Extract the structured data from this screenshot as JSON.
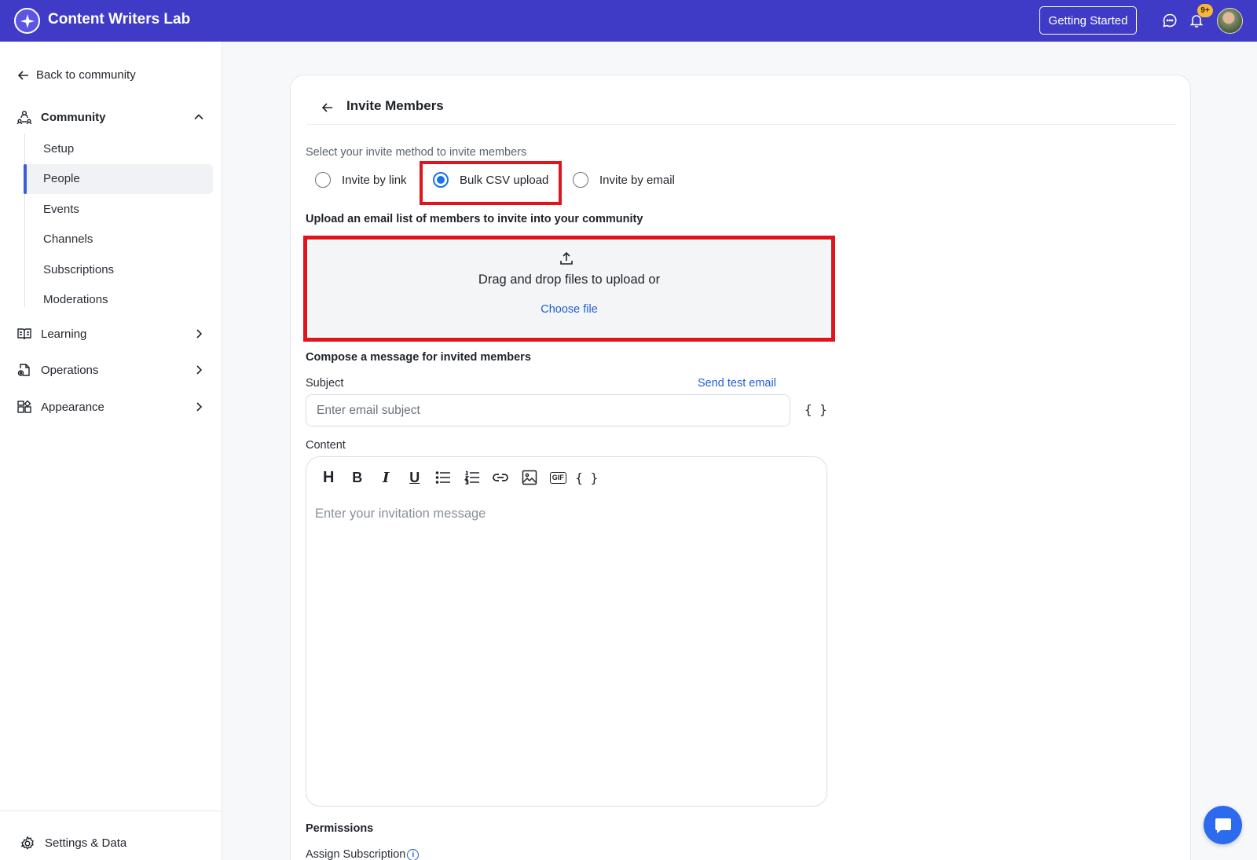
{
  "header": {
    "app_title": "Content Writers Lab",
    "getting_started": "Getting Started",
    "notification_count": "9+",
    "brand_color": "#3f3bc7"
  },
  "sidebar": {
    "back_label": "Back to community",
    "community": {
      "label": "Community",
      "items": [
        {
          "label": "Setup"
        },
        {
          "label": "People",
          "active": true
        },
        {
          "label": "Events"
        },
        {
          "label": "Channels"
        },
        {
          "label": "Subscriptions"
        },
        {
          "label": "Moderations"
        }
      ]
    },
    "groups": [
      {
        "label": "Learning",
        "icon": "book-icon"
      },
      {
        "label": "Operations",
        "icon": "operations-icon"
      },
      {
        "label": "Appearance",
        "icon": "appearance-icon"
      }
    ],
    "settings_label": "Settings & Data"
  },
  "main": {
    "title": "Invite Members",
    "method_prompt": "Select your invite method to invite members",
    "methods": [
      {
        "label": "Invite by link",
        "checked": false
      },
      {
        "label": "Bulk CSV upload",
        "checked": true
      },
      {
        "label": "Invite by email",
        "checked": false
      }
    ],
    "upload_heading": "Upload an email list of members to invite into your community",
    "upload_text": "Drag and drop files to upload or",
    "choose_file": "Choose file",
    "compose_heading": "Compose a message for invited members",
    "subject_label": "Subject",
    "send_test_email": "Send test email",
    "subject_placeholder": "Enter email subject",
    "variables_glyph": "{ }",
    "content_label": "Content",
    "editor_placeholder": "Enter your invitation message",
    "toolbar": {
      "heading": "H",
      "bold": "B",
      "italic": "I",
      "underline": "U",
      "gif": "GIF",
      "variables": "{ }"
    },
    "permissions_heading": "Permissions",
    "assign_subscription": "Assign Subscription"
  },
  "colors": {
    "highlight_red": "#e0141b",
    "link_blue": "#1f5fd4",
    "radio_blue": "#1a73e8",
    "chat_fab": "#2c6bed"
  }
}
